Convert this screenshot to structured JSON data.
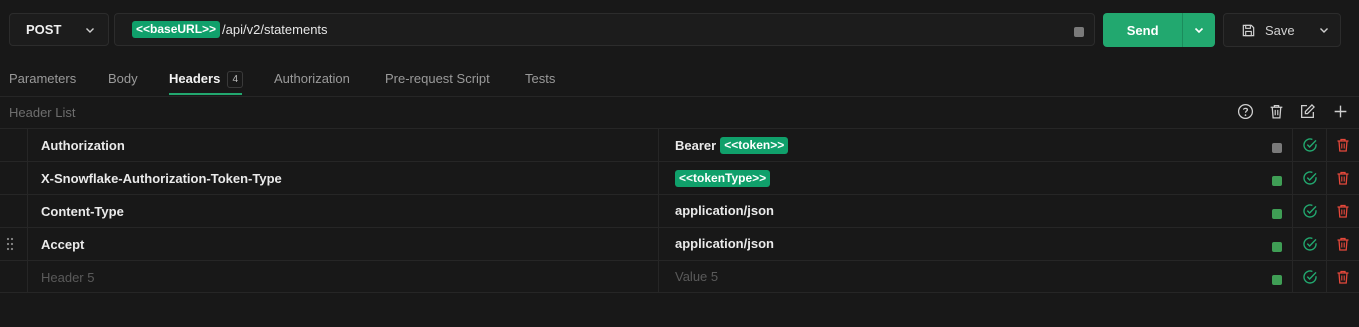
{
  "request": {
    "method": "POST",
    "url_variable": "<<baseURL>>",
    "url_path": "/api/v2/statements",
    "send_label": "Send",
    "save_label": "Save"
  },
  "tabs": [
    {
      "label": "Parameters"
    },
    {
      "label": "Body"
    },
    {
      "label": "Headers",
      "badge": "4"
    },
    {
      "label": "Authorization"
    },
    {
      "label": "Pre-request Script"
    },
    {
      "label": "Tests"
    }
  ],
  "active_tab": "Headers",
  "header_list": {
    "title": "Header List",
    "rows": [
      {
        "key": "Authorization",
        "value_prefix": "Bearer",
        "value_variable": "<<token>>",
        "enabled": false
      },
      {
        "key": "X-Snowflake-Authorization-Token-Type",
        "value_prefix": "",
        "value_variable": "<<tokenType>>",
        "enabled": true
      },
      {
        "key": "Content-Type",
        "value_prefix": "application/json",
        "value_variable": "",
        "enabled": true
      },
      {
        "key": "Accept",
        "value_prefix": "application/json",
        "value_variable": "",
        "enabled": true
      },
      {
        "key_placeholder": "Header 5",
        "value_placeholder": "Value 5",
        "enabled": true
      }
    ]
  },
  "colors": {
    "accent": "#22a86f",
    "variable_chip": "#10a06b",
    "delete": "#e5483b",
    "checkbox_on": "#3f9e55",
    "checkbox_off": "#7a7a7a"
  },
  "icons": {
    "method_dropdown": "chevron-down-icon",
    "send_dropdown": "chevron-down-icon",
    "save": "save-icon",
    "help": "help-circle-icon",
    "delete_all": "trash-icon",
    "bulk_edit": "edit-icon",
    "add": "plus-icon",
    "row_ok": "check-circle-icon",
    "row_delete": "trash-icon",
    "drag": "drag-handle-icon"
  }
}
